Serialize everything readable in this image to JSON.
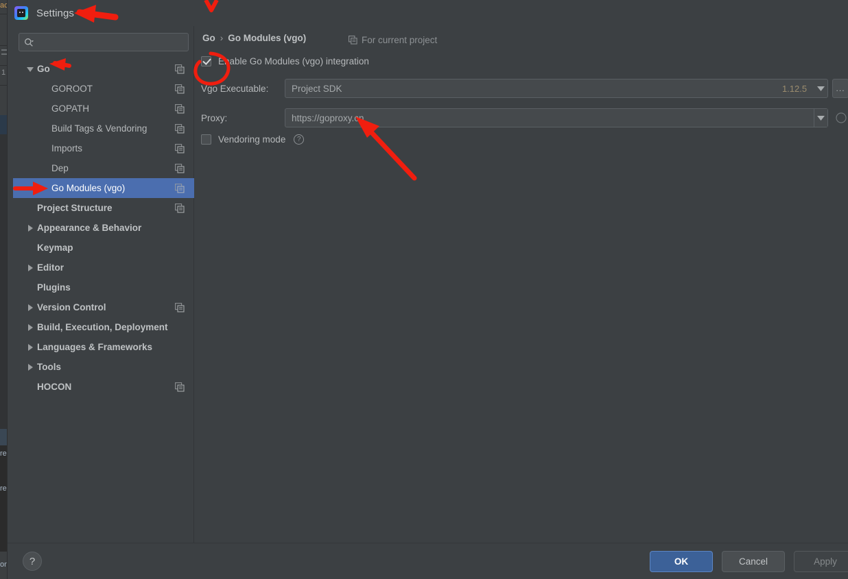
{
  "window": {
    "title": "Settings",
    "app_icon": "goland-icon"
  },
  "search": {
    "value": "",
    "placeholder": "",
    "icon": "search-icon"
  },
  "sidebar": {
    "items": [
      {
        "label": "Go",
        "level": 0,
        "arrow": "down",
        "bold": true,
        "copy": true,
        "selected": false
      },
      {
        "label": "GOROOT",
        "level": 1,
        "arrow": "none",
        "bold": false,
        "copy": true,
        "selected": false
      },
      {
        "label": "GOPATH",
        "level": 1,
        "arrow": "none",
        "bold": false,
        "copy": true,
        "selected": false
      },
      {
        "label": "Build Tags & Vendoring",
        "level": 1,
        "arrow": "none",
        "bold": false,
        "copy": true,
        "selected": false
      },
      {
        "label": "Imports",
        "level": 1,
        "arrow": "none",
        "bold": false,
        "copy": true,
        "selected": false
      },
      {
        "label": "Dep",
        "level": 1,
        "arrow": "none",
        "bold": false,
        "copy": true,
        "selected": false
      },
      {
        "label": "Go Modules (vgo)",
        "level": 1,
        "arrow": "none",
        "bold": false,
        "copy": true,
        "selected": true
      },
      {
        "label": "Project Structure",
        "level": 0,
        "arrow": "none",
        "bold": true,
        "copy": true,
        "selected": false
      },
      {
        "label": "Appearance & Behavior",
        "level": 0,
        "arrow": "right",
        "bold": true,
        "copy": false,
        "selected": false
      },
      {
        "label": "Keymap",
        "level": 0,
        "arrow": "none",
        "bold": true,
        "copy": false,
        "selected": false
      },
      {
        "label": "Editor",
        "level": 0,
        "arrow": "right",
        "bold": true,
        "copy": false,
        "selected": false
      },
      {
        "label": "Plugins",
        "level": 0,
        "arrow": "none",
        "bold": true,
        "copy": false,
        "selected": false
      },
      {
        "label": "Version Control",
        "level": 0,
        "arrow": "right",
        "bold": true,
        "copy": true,
        "selected": false
      },
      {
        "label": "Build, Execution, Deployment",
        "level": 0,
        "arrow": "right",
        "bold": true,
        "copy": false,
        "selected": false
      },
      {
        "label": "Languages & Frameworks",
        "level": 0,
        "arrow": "right",
        "bold": true,
        "copy": false,
        "selected": false
      },
      {
        "label": "Tools",
        "level": 0,
        "arrow": "right",
        "bold": true,
        "copy": false,
        "selected": false
      },
      {
        "label": "HOCON",
        "level": 0,
        "arrow": "none",
        "bold": true,
        "copy": true,
        "selected": false
      }
    ]
  },
  "content": {
    "breadcrumb": {
      "root": "Go",
      "separator": "›",
      "current": "Go Modules (vgo)"
    },
    "scope_label": "For current project",
    "enable_checkbox": {
      "label": "Enable Go Modules (vgo) integration",
      "checked": true
    },
    "vgo_executable": {
      "label": "Vgo Executable:",
      "value": "Project SDK",
      "version": "1.12.5",
      "browse_label": "..."
    },
    "proxy": {
      "label": "Proxy:",
      "value": "https://goproxy.cn"
    },
    "vendoring": {
      "label": "Vendoring mode",
      "checked": false,
      "help_glyph": "?"
    }
  },
  "footer": {
    "help_glyph": "?",
    "ok_label": "OK",
    "cancel_label": "Cancel",
    "apply_label": "Apply"
  },
  "ide_background": {
    "fragments": [
      "ac",
      "1",
      "re",
      "re",
      "on"
    ]
  },
  "colors": {
    "dialog_bg": "#3c4043",
    "selection_blue": "#4b6eaf",
    "ok_button_blue": "#3c6198",
    "annotation_red": "#f01e0f",
    "text_primary": "#b6b9bb",
    "text_muted": "#8d9194",
    "version_gold": "#9b8c6e"
  }
}
